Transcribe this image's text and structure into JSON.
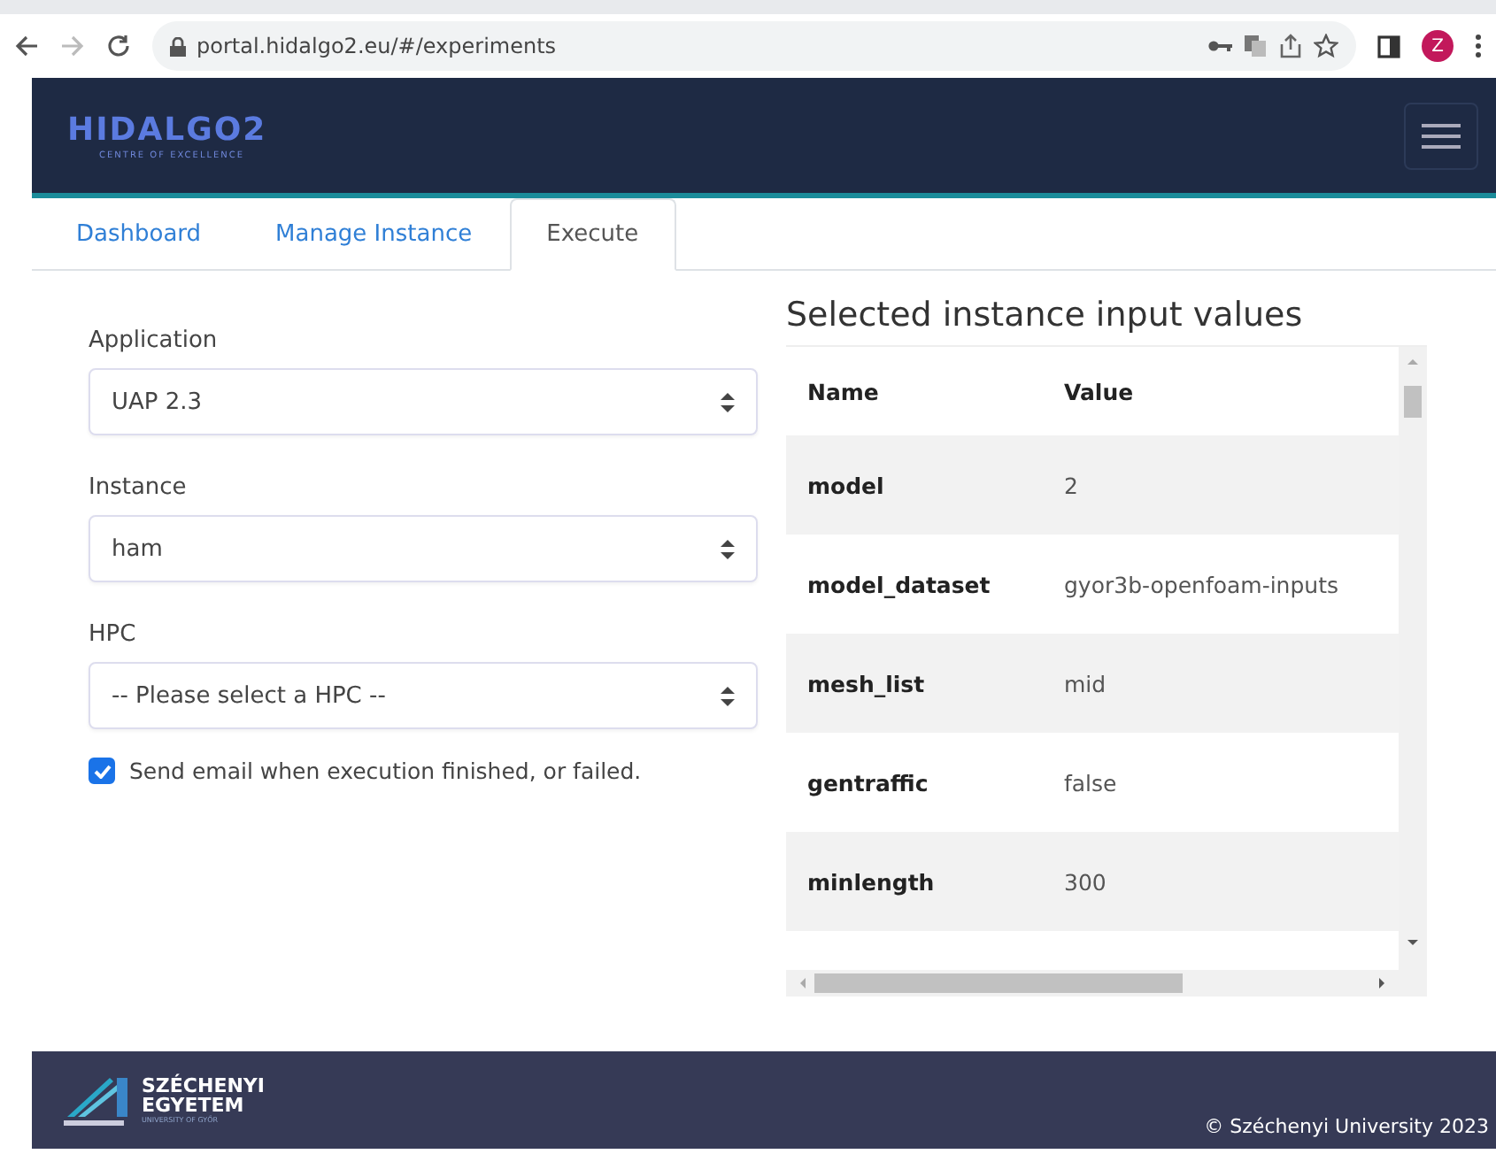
{
  "browser": {
    "url": "portal.hidalgo2.eu/#/experiments",
    "profile_initial": "Z"
  },
  "header": {
    "logo_text": "HIDALGO2",
    "logo_subtitle": "CENTRE OF EXCELLENCE"
  },
  "tabs": [
    {
      "label": "Dashboard",
      "selected": false
    },
    {
      "label": "Manage Instance",
      "selected": false
    },
    {
      "label": "Execute",
      "selected": true
    }
  ],
  "form": {
    "fields": [
      {
        "label": "Application",
        "value": "UAP 2.3"
      },
      {
        "label": "Instance",
        "value": "ham"
      },
      {
        "label": "HPC",
        "value": "-- Please select a HPC --"
      }
    ],
    "notify": {
      "label": "Send email when execution finished, or failed.",
      "checked": true
    }
  },
  "table": {
    "title": "Selected instance input values",
    "columns": [
      "Name",
      "Value"
    ],
    "rows": [
      [
        "model",
        "2"
      ],
      [
        "model_dataset",
        "gyor3b-openfoam-inputs"
      ],
      [
        "mesh_list",
        "mid"
      ],
      [
        "gentraffic",
        "false"
      ],
      [
        "minlength",
        "300"
      ]
    ]
  },
  "footer": {
    "logo_lines": [
      "SZÉCHENYI",
      "EGYETEM"
    ],
    "logo_small": "UNIVERSITY OF GYŐR",
    "copyright": "© Széchenyi University 2023"
  }
}
